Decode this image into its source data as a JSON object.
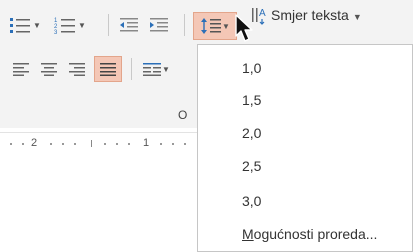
{
  "ribbon": {
    "text_direction_label": "Smjer teksta",
    "partial_group_label": "O"
  },
  "ruler": {
    "labels": [
      "2",
      "1"
    ]
  },
  "line_spacing_menu": {
    "options": [
      "1,0",
      "1,5",
      "2,0",
      "2,5",
      "3,0"
    ],
    "more_options_first": "M",
    "more_options_rest": "ogućnosti proreda..."
  },
  "colors": {
    "active_button_bg": "#f4c7b6",
    "icon_blue": "#2b6fb8",
    "ribbon_bg": "#f3f3f3"
  }
}
